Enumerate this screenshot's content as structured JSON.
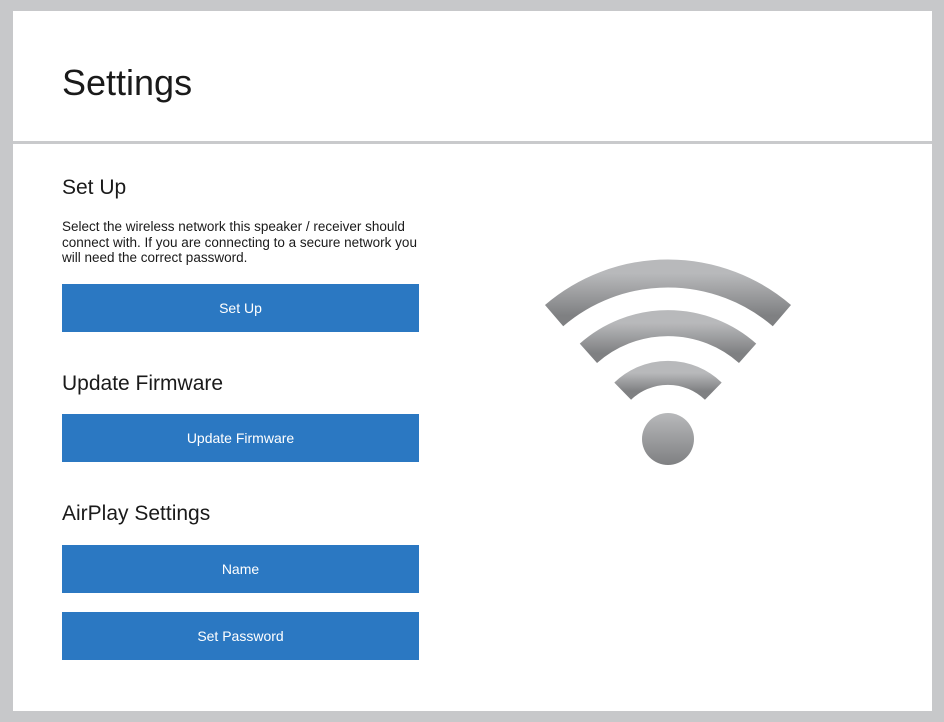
{
  "header": {
    "title": "Settings"
  },
  "setup": {
    "heading": "Set Up",
    "description": "Select the wireless network this speaker / receiver should connect with. If you are connecting to a secure network you will need the correct password.",
    "button_label": "Set Up"
  },
  "firmware": {
    "heading": "Update Firmware",
    "button_label": "Update Firmware"
  },
  "airplay": {
    "heading": "AirPlay Settings",
    "name_button_label": "Name",
    "password_button_label": "Set Password"
  },
  "illustration": {
    "icon": "wifi-icon"
  },
  "colors": {
    "button_background": "#2b78c2",
    "button_text": "#ffffff",
    "page_background": "#c7c8ca",
    "wifi_icon": "#8e8f91"
  }
}
